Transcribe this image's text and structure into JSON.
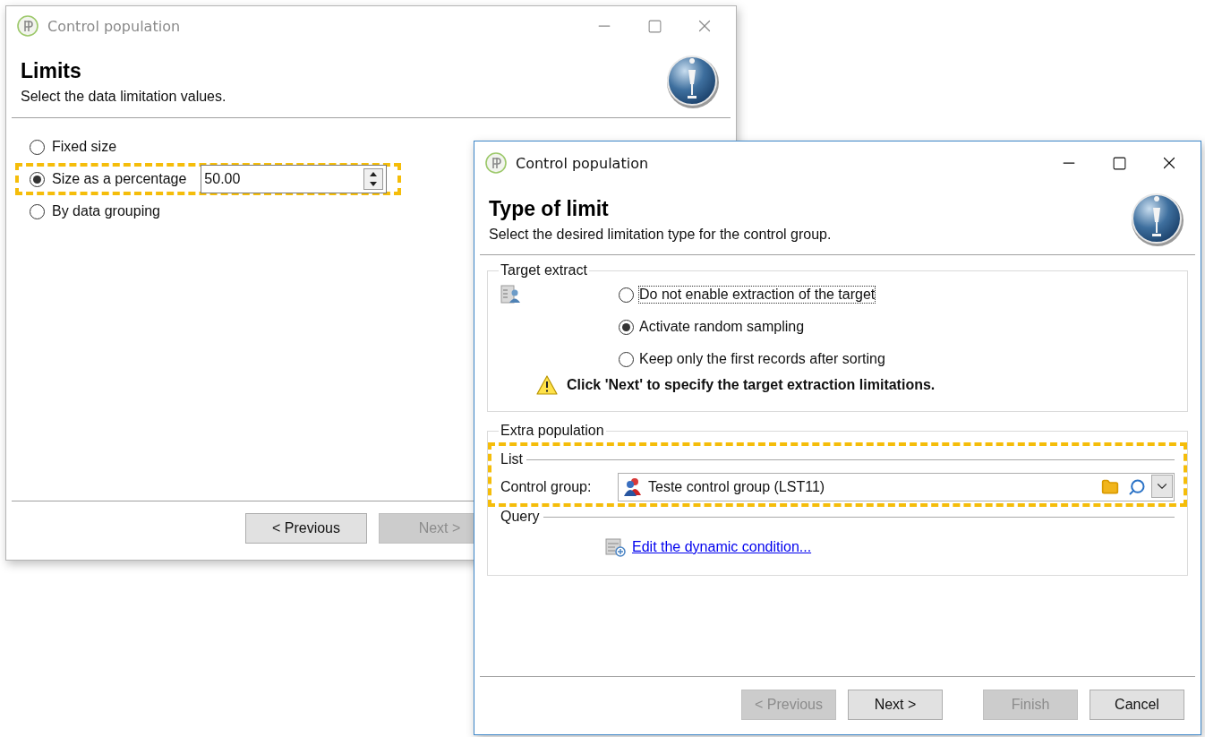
{
  "limits_window": {
    "title": "Control population",
    "active": false,
    "heading": "Limits",
    "subtitle": "Select the data limitation values.",
    "options": [
      {
        "label": "Fixed size",
        "selected": false,
        "highlighted": false
      },
      {
        "label": "Size as a percentage",
        "selected": true,
        "highlighted": true,
        "value": "50.00"
      },
      {
        "label": "By data grouping",
        "selected": false,
        "highlighted": false
      }
    ],
    "buttons": [
      {
        "label": "< Previous",
        "disabled": false
      },
      {
        "label": "Next >",
        "disabled": true
      }
    ]
  },
  "type_window": {
    "title": "Control population",
    "active": true,
    "heading": "Type of limit",
    "subtitle": "Select the desired limitation type for the control group.",
    "target_extract": {
      "title": "Target extract",
      "options": [
        {
          "label": "Do not enable extraction of the target",
          "selected": false,
          "focused": true
        },
        {
          "label": "Activate random sampling",
          "selected": true,
          "focused": false
        },
        {
          "label": "Keep only the first records after sorting",
          "selected": false,
          "focused": false
        }
      ],
      "warning": "Click 'Next' to specify the target extraction limitations."
    },
    "extra_population": {
      "title": "Extra population",
      "list": {
        "title": "List",
        "highlighted": true,
        "field_label": "Control group:",
        "value": "Teste control group (LST11)"
      },
      "query": {
        "title": "Query",
        "link": "Edit the dynamic condition..."
      }
    },
    "buttons": [
      {
        "label": "< Previous",
        "disabled": true
      },
      {
        "label": "Next >",
        "disabled": false
      },
      {
        "label": "Finish",
        "disabled": true
      },
      {
        "label": "Cancel",
        "disabled": false
      }
    ]
  }
}
